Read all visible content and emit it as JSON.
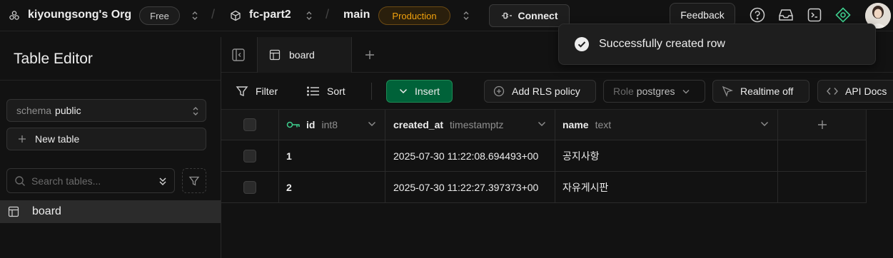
{
  "topbar": {
    "org_name": "kiyoungsong's Org",
    "plan_badge": "Free",
    "project_name": "fc-part2",
    "branch_name": "main",
    "env_badge": "Production",
    "connect_label": "Connect",
    "feedback_label": "Feedback",
    "icons": [
      "help-icon",
      "inbox-icon",
      "terminal-icon",
      "advisor-icon"
    ]
  },
  "sidebar": {
    "title": "Table Editor",
    "schema_label": "schema",
    "schema_value": "public",
    "new_table_label": "New table",
    "search_placeholder": "Search tables...",
    "items": [
      {
        "label": "board"
      }
    ]
  },
  "tabs": [
    {
      "label": "board"
    }
  ],
  "toolbar": {
    "filter_label": "Filter",
    "sort_label": "Sort",
    "insert_label": "Insert",
    "rls_label": "Add RLS policy",
    "role_label": "Role",
    "role_value": "postgres",
    "realtime_label": "Realtime off",
    "api_docs_label": "API Docs"
  },
  "grid": {
    "columns": [
      {
        "name": "id",
        "type": "int8"
      },
      {
        "name": "created_at",
        "type": "timestamptz"
      },
      {
        "name": "name",
        "type": "text"
      }
    ],
    "rows": [
      {
        "id": "1",
        "created_at": "2025-07-30 11:22:08.694493+00",
        "name": "공지사항"
      },
      {
        "id": "2",
        "created_at": "2025-07-30 11:22:27.397373+00",
        "name": "자유게시판"
      }
    ]
  },
  "toast": {
    "message": "Successfully created row"
  },
  "colors": {
    "accent_green": "#3ecf8e",
    "insert_bg": "#006239",
    "production_amber": "#f1a10d"
  }
}
